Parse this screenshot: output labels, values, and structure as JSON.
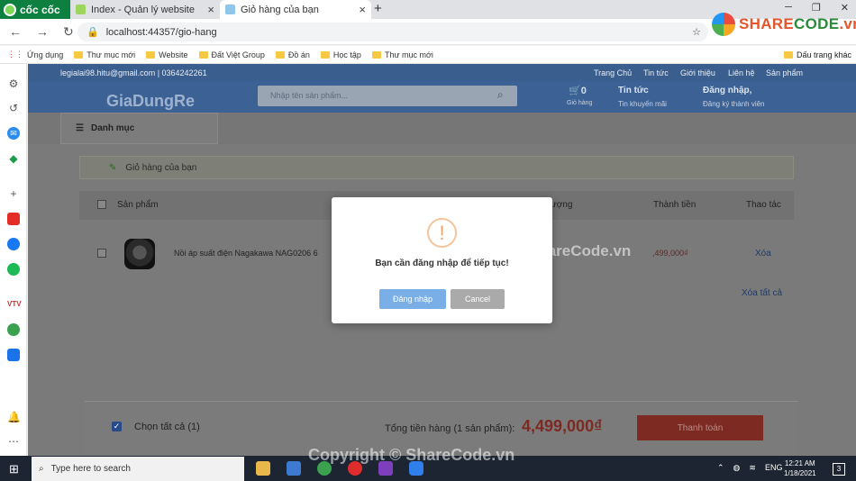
{
  "browser": {
    "brand": "cốc cốc",
    "tabs": [
      {
        "label": "Index - Quản lý website"
      },
      {
        "label": "Giỏ hàng của bạn"
      }
    ],
    "url": "localhost:44357/gio-hang",
    "bookmarks": [
      "Ứng dụng",
      "Thư mục mới",
      "Website",
      "Đất Việt Group",
      "Đồ án",
      "Học tập",
      "Thư mục mới"
    ],
    "bookmarks_other": "Dấu trang khác"
  },
  "watermark_logo": {
    "share": "SHARE",
    "code": "CODE",
    "vn": ".vn"
  },
  "site": {
    "contact": "legialai98.hitu@gmail.com | 0364242261",
    "top_links": [
      "Trang Chủ",
      "Tin tức",
      "Giới thiệu",
      "Liên hệ",
      "Sản phẩm"
    ],
    "brand": "GiaDungRe",
    "search_placeholder": "Nhập tên sản phẩm...",
    "cart_count": "0",
    "cart_label": "Giỏ hàng",
    "news_title": "Tin tức",
    "news_sub": "Tin khuyến mãi",
    "login_title": "Đăng nhập,",
    "login_sub": "Đăng ký thành viên",
    "category_label": "Danh mục",
    "breadcrumb": "Giỏ hàng của bạn"
  },
  "cart": {
    "headers": {
      "product": "Sản phẩm",
      "quantity": "ượng",
      "subtotal": "Thành tiền",
      "actions": "Thao tác"
    },
    "items": [
      {
        "name": "Nồi áp suất điện Nagakawa NAG0206 6",
        "subtotal": ",499,000₫",
        "delete": "Xóa"
      }
    ],
    "clear_all": "Xóa tất cả",
    "select_all": "Chọn tất cả (1)",
    "total_label": "Tổng tiền hàng (1 sản phẩm):",
    "total_value": "4,499,000₫",
    "checkout": "Thanh toán"
  },
  "modal": {
    "icon": "!",
    "message": "Bạn cần đăng nhập để tiếp tục!",
    "confirm": "Đăng nhập",
    "cancel": "Cancel"
  },
  "watermarks": [
    "ShareCode.vn",
    "Copyright © ShareCode.vn"
  ],
  "taskbar": {
    "search_placeholder": "Type here to search",
    "lang": "ENG",
    "time": "12:21 AM",
    "date": "1/18/2021",
    "notifications": "3"
  },
  "colors": {
    "header_blue": "#3c6194",
    "price_red": "#d33b2b",
    "pay_red": "#d9422f",
    "login_blue": "#5b9ae6"
  }
}
